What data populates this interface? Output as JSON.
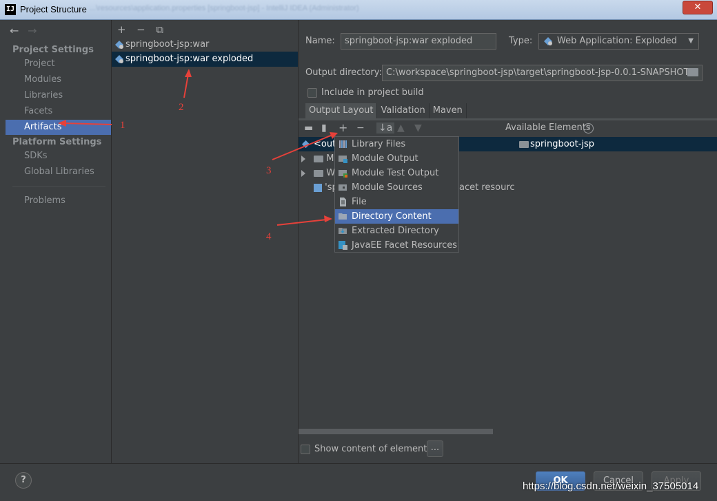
{
  "window": {
    "title": "Project Structure",
    "title_blurred": "...\\resources\\application.properties [springboot-jsp] - IntelliJ IDEA (Administrator)",
    "close_label": "✕",
    "app_icon": "IJ"
  },
  "nav": {
    "back_icon": "←",
    "forward_icon": "→",
    "project_settings_header": "Project Settings",
    "project_items": [
      "Project",
      "Modules",
      "Libraries",
      "Facets",
      "Artifacts"
    ],
    "platform_settings_header": "Platform Settings",
    "platform_items": [
      "SDKs",
      "Global Libraries"
    ],
    "problems": "Problems",
    "selected": "Artifacts"
  },
  "artifacts": {
    "toolbar": {
      "add": "+",
      "remove": "−",
      "copy": "⧉"
    },
    "items": [
      "springboot-jsp:war",
      "springboot-jsp:war exploded"
    ],
    "selected": "springboot-jsp:war exploded"
  },
  "detail": {
    "name_label": "Name:",
    "name_value": "springboot-jsp:war exploded",
    "type_label": "Type:",
    "type_value": "Web Application: Exploded",
    "output_dir_label": "Output directory:",
    "output_dir_value": "C:\\workspace\\springboot-jsp\\target\\springboot-jsp-0.0.1-SNAPSHOT",
    "include_build_label": "Include in project build",
    "tabs": [
      "Output Layout",
      "Validation",
      "Maven"
    ],
    "active_tab": "Output Layout",
    "available_label": "Available Elements",
    "help_icon": "?",
    "available_items": [
      "springboot-jsp"
    ],
    "tree_rows": [
      "<outp",
      "M",
      "W",
      "'sp"
    ],
    "tree_partial_text": "acet resourc",
    "show_content_label": "Show content of elements",
    "ellipsis_button": "..."
  },
  "popup_menu": {
    "items": [
      "Library Files",
      "Module Output",
      "Module Test Output",
      "Module Sources",
      "File",
      "Directory Content",
      "Extracted Directory",
      "JavaEE Facet Resources"
    ],
    "selected": "Directory Content"
  },
  "bottom": {
    "help": "?",
    "ok": "OK",
    "cancel": "Cancel",
    "apply": "Apply"
  },
  "annotations": [
    "1",
    "2",
    "3",
    "4"
  ],
  "watermark": "https://blog.csdn.net/weixin_37505014",
  "colors": {
    "background": "#3c3f41",
    "selection": "#4b6eaf",
    "tree_selection": "#0d293e",
    "annotation": "#e6413a"
  }
}
